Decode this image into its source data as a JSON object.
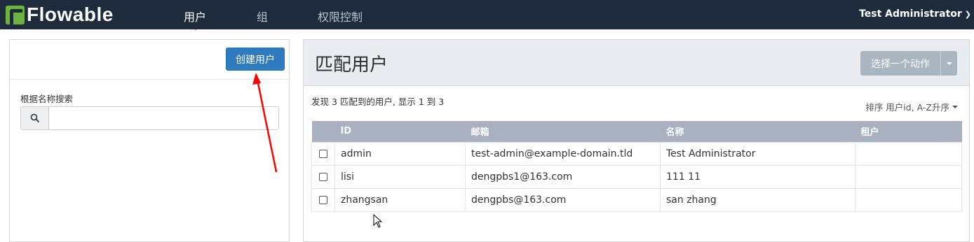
{
  "brand": "Flowable",
  "nav": [
    {
      "label": "用户",
      "active": true
    },
    {
      "label": "组",
      "active": false
    },
    {
      "label": "权限控制",
      "active": false
    }
  ],
  "user_menu": {
    "name": "Test Administrator"
  },
  "left": {
    "create_button": "创建用户",
    "search_label": "根据名称搜索",
    "search_value": ""
  },
  "right": {
    "title": "匹配用户",
    "action_button": "选择一个动作",
    "summary": "发现 3 匹配到的用户, 显示 1 到 3",
    "sort_label": "排序 用户id, A-Z升序",
    "columns": [
      "ID",
      "邮箱",
      "名称",
      "租户"
    ],
    "rows": [
      {
        "id": "admin",
        "email": "test-admin@example-domain.tld",
        "name": "Test Administrator",
        "tenant": ""
      },
      {
        "id": "lisi",
        "email": "dengpbs1@163.com",
        "name": "111 11",
        "tenant": ""
      },
      {
        "id": "zhangsan",
        "email": "dengpbs@163.com",
        "name": "san zhang",
        "tenant": ""
      }
    ]
  },
  "colors": {
    "topbar": "#1e2b3c",
    "primary": "#2f7bbf",
    "header_row": "#a9b0bf",
    "annotation_arrow": "#ff0000"
  }
}
